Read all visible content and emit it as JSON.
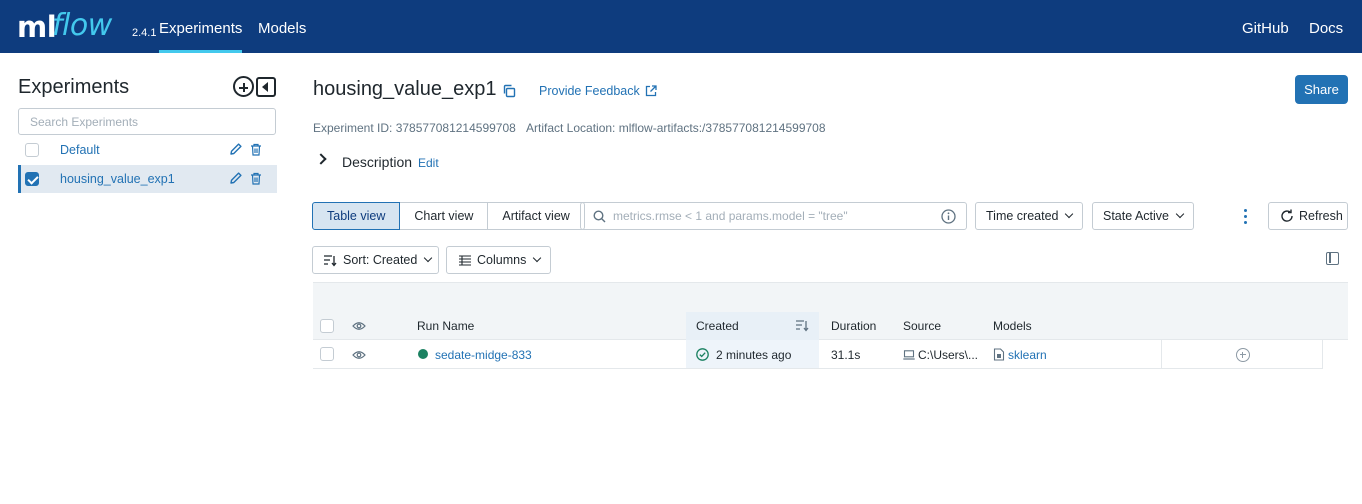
{
  "nav": {
    "logo_ml": "ml",
    "logo_flow": "flow",
    "version": "2.4.1",
    "experiments": "Experiments",
    "models": "Models",
    "github": "GitHub",
    "docs": "Docs",
    "accent": "#43c9ed",
    "background": "#0e3c7e"
  },
  "sidebar": {
    "title": "Experiments",
    "search_placeholder": "Search Experiments",
    "experiments": [
      {
        "name": "Default",
        "selected": false
      },
      {
        "name": "housing_value_exp1",
        "selected": true
      }
    ]
  },
  "header": {
    "title": "housing_value_exp1",
    "feedback": "Provide Feedback",
    "share": "Share",
    "experiment_id": "Experiment ID: 378577081214599708",
    "artifact_location": "Artifact Location: mlflow-artifacts:/378577081214599708",
    "description": "Description",
    "edit": "Edit"
  },
  "toolbar": {
    "views": [
      "Table view",
      "Chart view",
      "Artifact view"
    ],
    "active_view": "Table view",
    "search_placeholder": "metrics.rmse < 1 and params.model = \"tree\"",
    "time_created": "Time created",
    "state": "State Active",
    "refresh": "Refresh",
    "sort": "Sort: Created",
    "columns": "Columns"
  },
  "table": {
    "headers": {
      "run_name": "Run Name",
      "created": "Created",
      "duration": "Duration",
      "source": "Source",
      "models": "Models"
    },
    "rows": [
      {
        "run_name": "sedate-midge-833",
        "created": "2 minutes ago",
        "duration": "31.1s",
        "source": "C:\\Users\\...",
        "model": "sklearn",
        "status_color": "#1b8161"
      }
    ]
  }
}
